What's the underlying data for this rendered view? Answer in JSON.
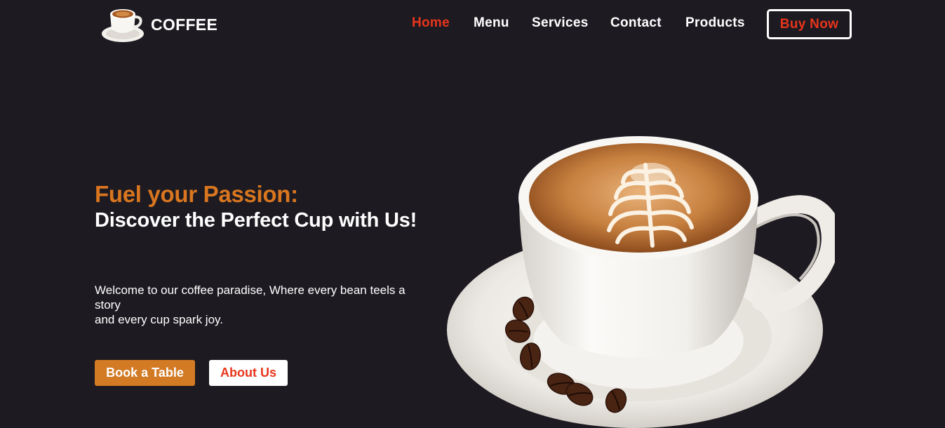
{
  "brand": {
    "name": "COFFEE",
    "logo_icon": "coffee-cup-icon"
  },
  "nav": {
    "items": [
      {
        "label": "Home",
        "active": true
      },
      {
        "label": "Menu",
        "active": false
      },
      {
        "label": "Services",
        "active": false
      },
      {
        "label": "Contact",
        "active": false
      },
      {
        "label": "Products",
        "active": false
      }
    ],
    "cta_label": "Buy Now"
  },
  "hero": {
    "kicker": "Fuel your Passion:",
    "title": "Discover the Perfect Cup with Us!",
    "description_line1": "Welcome to our coffee paradise, Where every bean teels a story",
    "description_line2": "and every cup spark joy.",
    "primary_button": "Book a Table",
    "secondary_button": "About Us",
    "image_icon": "cappuccino-cup-image"
  },
  "colors": {
    "background": "#1d1a21",
    "accent_red": "#e8351c",
    "accent_orange": "#d9761f",
    "button_orange": "#d27a24",
    "text": "#ffffff"
  }
}
